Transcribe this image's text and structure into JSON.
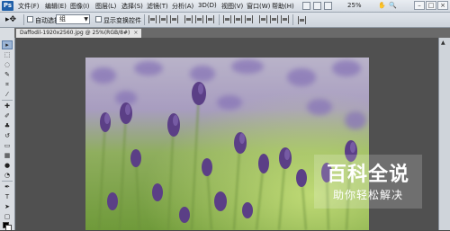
{
  "app": {
    "logo_text": "Ps"
  },
  "menubar": {
    "items": [
      "文件(F)",
      "编辑(E)",
      "图像(I)",
      "图层(L)",
      "选择(S)",
      "滤镜(T)",
      "分析(A)",
      "3D(D)",
      "视图(V)",
      "窗口(W)",
      "帮助(H)"
    ],
    "zoom": "25%",
    "window_buttons": [
      "–",
      "□",
      "×"
    ]
  },
  "options": {
    "auto_select_label": "自动选择:",
    "auto_select_value": "组",
    "show_transform_label": "显示变换控件"
  },
  "document": {
    "tab_title": "Daffodil-1920x2560.jpg @ 25%(RGB/8#)",
    "tab_close": "×"
  },
  "watermark": {
    "title": "百科全说",
    "subtitle": "助你轻松解决"
  },
  "colors": {
    "foreground": "#000000",
    "background": "#ffffff",
    "accent": "#1f5fa8"
  }
}
